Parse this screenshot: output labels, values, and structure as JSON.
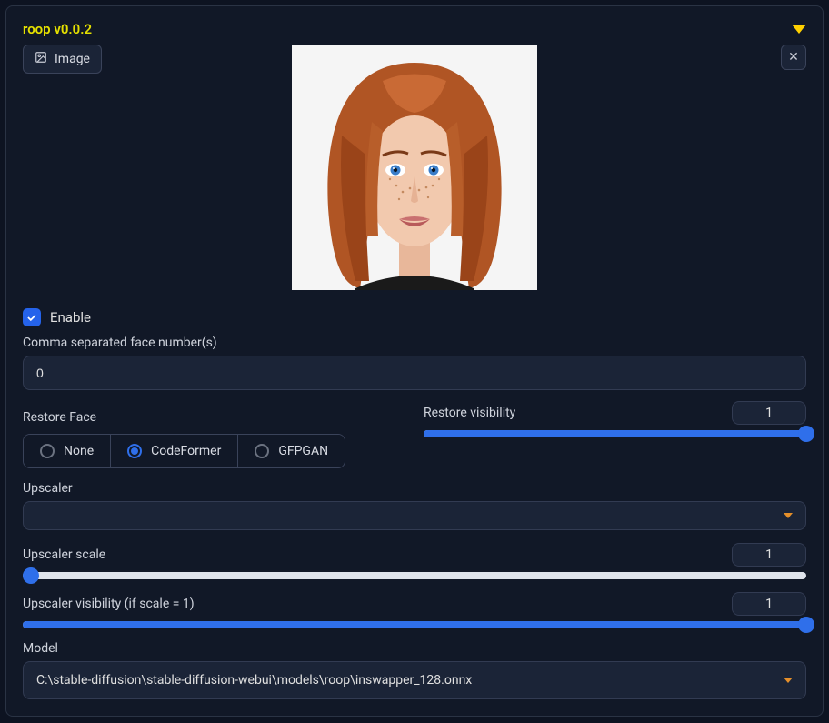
{
  "header": {
    "title": "roop v0.0.2",
    "image_tab_label": "Image"
  },
  "enable": {
    "label": "Enable",
    "checked": true
  },
  "face_numbers": {
    "label": "Comma separated face number(s)",
    "value": "0"
  },
  "restore_face": {
    "label": "Restore Face",
    "options": [
      "None",
      "CodeFormer",
      "GFPGAN"
    ],
    "selected": "CodeFormer"
  },
  "restore_visibility": {
    "label": "Restore visibility",
    "value": "1",
    "fill_percent": 100
  },
  "upscaler": {
    "label": "Upscaler",
    "value": ""
  },
  "upscaler_scale": {
    "label": "Upscaler scale",
    "value": "1",
    "fill_percent": 0
  },
  "upscaler_visibility": {
    "label": "Upscaler visibility (if scale = 1)",
    "value": "1",
    "fill_percent": 100
  },
  "model": {
    "label": "Model",
    "value": "C:\\stable-diffusion\\stable-diffusion-webui\\models\\roop\\inswapper_128.onnx"
  }
}
